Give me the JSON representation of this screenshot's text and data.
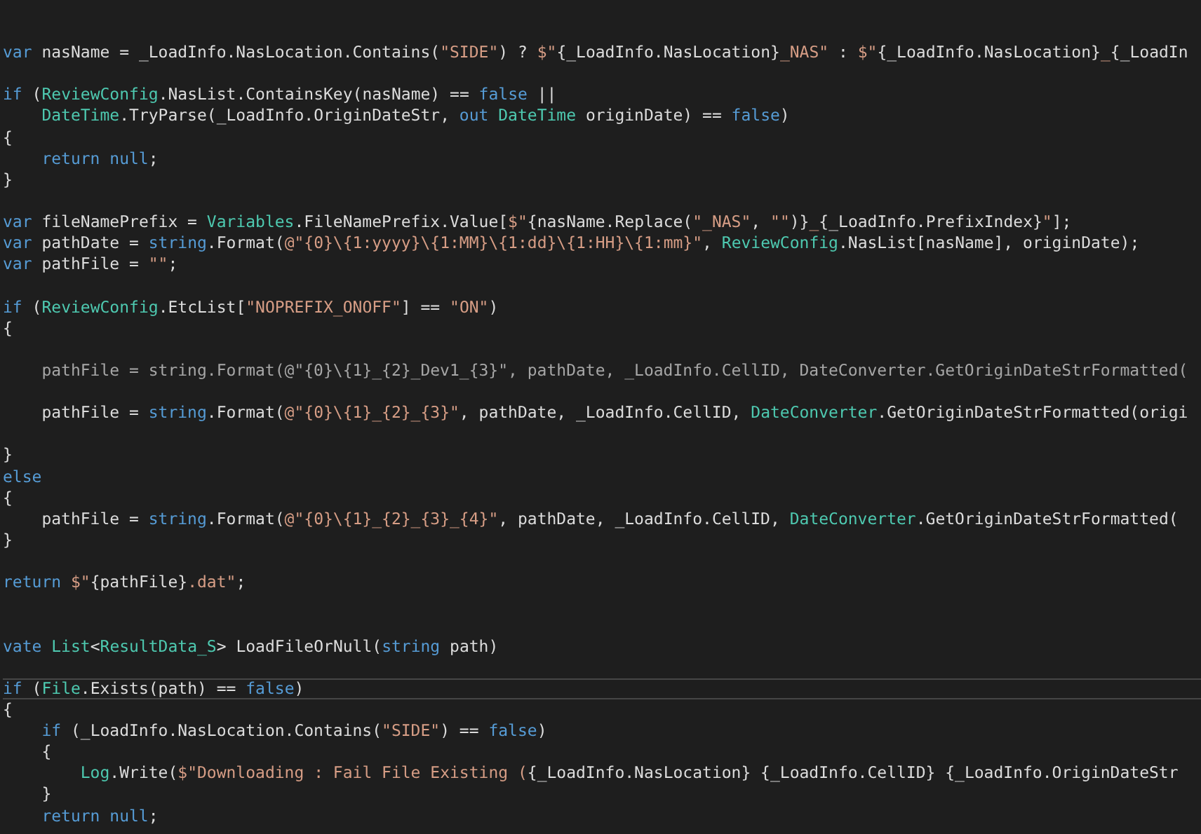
{
  "editor": {
    "lines": [
      {
        "kind": "code",
        "current": false,
        "tokens": [
          {
            "kind": "kw",
            "text": "var"
          },
          {
            "kind": "plain",
            "text": " nasName = _LoadInfo.NasLocation.Contains("
          },
          {
            "kind": "str",
            "text": "\"SIDE\""
          },
          {
            "kind": "plain",
            "text": ") ? "
          },
          {
            "kind": "str",
            "text": "$\""
          },
          {
            "kind": "plain",
            "text": "{_LoadInfo.NasLocation}"
          },
          {
            "kind": "str",
            "text": "_NAS\""
          },
          {
            "kind": "plain",
            "text": " : "
          },
          {
            "kind": "str",
            "text": "$\""
          },
          {
            "kind": "plain",
            "text": "{_LoadInfo.NasLocation}"
          },
          {
            "kind": "str",
            "text": "_"
          },
          {
            "kind": "plain",
            "text": "{_LoadIn"
          }
        ]
      },
      {
        "kind": "blank"
      },
      {
        "kind": "code",
        "current": false,
        "tokens": [
          {
            "kind": "kw",
            "text": "if"
          },
          {
            "kind": "plain",
            "text": " ("
          },
          {
            "kind": "type",
            "text": "ReviewConfig"
          },
          {
            "kind": "plain",
            "text": ".NasList.ContainsKey(nasName) == "
          },
          {
            "kind": "kw",
            "text": "false"
          },
          {
            "kind": "plain",
            "text": " ||"
          }
        ]
      },
      {
        "kind": "code",
        "current": false,
        "tokens": [
          {
            "kind": "type",
            "text": "    DateTime"
          },
          {
            "kind": "plain",
            "text": ".TryParse(_LoadInfo.OriginDateStr, "
          },
          {
            "kind": "kw",
            "text": "out "
          },
          {
            "kind": "type",
            "text": "DateTime"
          },
          {
            "kind": "plain",
            "text": " originDate) == "
          },
          {
            "kind": "kw",
            "text": "false"
          },
          {
            "kind": "plain",
            "text": ")"
          }
        ]
      },
      {
        "kind": "code",
        "current": false,
        "tokens": [
          {
            "kind": "plain",
            "text": "{"
          }
        ]
      },
      {
        "kind": "code",
        "current": false,
        "tokens": [
          {
            "kind": "kw",
            "text": "    return null"
          },
          {
            "kind": "plain",
            "text": ";"
          }
        ]
      },
      {
        "kind": "code",
        "current": false,
        "tokens": [
          {
            "kind": "plain",
            "text": "}"
          }
        ]
      },
      {
        "kind": "blank"
      },
      {
        "kind": "code",
        "current": false,
        "tokens": [
          {
            "kind": "kw",
            "text": "var"
          },
          {
            "kind": "plain",
            "text": " fileNamePrefix = "
          },
          {
            "kind": "type",
            "text": "Variables"
          },
          {
            "kind": "plain",
            "text": ".FileNamePrefix.Value["
          },
          {
            "kind": "str",
            "text": "$\""
          },
          {
            "kind": "plain",
            "text": "{nasName.Replace("
          },
          {
            "kind": "str",
            "text": "\"_NAS\""
          },
          {
            "kind": "plain",
            "text": ", "
          },
          {
            "kind": "str",
            "text": "\"\""
          },
          {
            "kind": "plain",
            "text": ")}"
          },
          {
            "kind": "str",
            "text": "_"
          },
          {
            "kind": "plain",
            "text": "{_LoadInfo.PrefixIndex}"
          },
          {
            "kind": "str",
            "text": "\""
          },
          {
            "kind": "plain",
            "text": "];"
          }
        ]
      },
      {
        "kind": "code",
        "current": false,
        "tokens": [
          {
            "kind": "kw",
            "text": "var"
          },
          {
            "kind": "plain",
            "text": " pathDate = "
          },
          {
            "kind": "kw",
            "text": "string"
          },
          {
            "kind": "plain",
            "text": ".Format("
          },
          {
            "kind": "str",
            "text": "@\"{0}\\{1:yyyy}\\{1:MM}\\{1:dd}\\{1:HH}\\{1:mm}\""
          },
          {
            "kind": "plain",
            "text": ", "
          },
          {
            "kind": "type",
            "text": "ReviewConfig"
          },
          {
            "kind": "plain",
            "text": ".NasList[nasName], originDate);"
          }
        ]
      },
      {
        "kind": "code",
        "current": false,
        "tokens": [
          {
            "kind": "kw",
            "text": "var"
          },
          {
            "kind": "plain",
            "text": " pathFile = "
          },
          {
            "kind": "str",
            "text": "\"\""
          },
          {
            "kind": "plain",
            "text": ";"
          }
        ]
      },
      {
        "kind": "blank"
      },
      {
        "kind": "code",
        "current": false,
        "tokens": [
          {
            "kind": "kw",
            "text": "if"
          },
          {
            "kind": "plain",
            "text": " ("
          },
          {
            "kind": "type",
            "text": "ReviewConfig"
          },
          {
            "kind": "plain",
            "text": ".EtcList["
          },
          {
            "kind": "str",
            "text": "\"NOPREFIX_ONOFF\""
          },
          {
            "kind": "plain",
            "text": "] == "
          },
          {
            "kind": "str",
            "text": "\"ON\""
          },
          {
            "kind": "plain",
            "text": ")"
          }
        ]
      },
      {
        "kind": "code",
        "current": false,
        "tokens": [
          {
            "kind": "plain",
            "text": "{"
          }
        ]
      },
      {
        "kind": "blank"
      },
      {
        "kind": "code",
        "current": false,
        "tokens": [
          {
            "kind": "dim",
            "text": "    pathFile = string.Format(@\"{0}\\{1}_{2}_Dev1_{3}\", pathDate, _LoadInfo.CellID, DateConverter.GetOriginDateStrFormatted("
          }
        ]
      },
      {
        "kind": "blank"
      },
      {
        "kind": "code",
        "current": false,
        "tokens": [
          {
            "kind": "plain",
            "text": "    pathFile = "
          },
          {
            "kind": "kw",
            "text": "string"
          },
          {
            "kind": "plain",
            "text": ".Format("
          },
          {
            "kind": "str",
            "text": "@\"{0}\\{1}_{2}_{3}\""
          },
          {
            "kind": "plain",
            "text": ", pathDate, _LoadInfo.CellID, "
          },
          {
            "kind": "type",
            "text": "DateConverter"
          },
          {
            "kind": "plain",
            "text": ".GetOriginDateStrFormatted(origi"
          }
        ]
      },
      {
        "kind": "blank"
      },
      {
        "kind": "code",
        "current": false,
        "tokens": [
          {
            "kind": "plain",
            "text": "}"
          }
        ]
      },
      {
        "kind": "code",
        "current": false,
        "tokens": [
          {
            "kind": "kw",
            "text": "else"
          }
        ]
      },
      {
        "kind": "code",
        "current": false,
        "tokens": [
          {
            "kind": "plain",
            "text": "{"
          }
        ]
      },
      {
        "kind": "code",
        "current": false,
        "tokens": [
          {
            "kind": "plain",
            "text": "    pathFile = "
          },
          {
            "kind": "kw",
            "text": "string"
          },
          {
            "kind": "plain",
            "text": ".Format("
          },
          {
            "kind": "str",
            "text": "@\"{0}\\{1}_{2}_{3}_{4}\""
          },
          {
            "kind": "plain",
            "text": ", pathDate, _LoadInfo.CellID, "
          },
          {
            "kind": "type",
            "text": "DateConverter"
          },
          {
            "kind": "plain",
            "text": ".GetOriginDateStrFormatted("
          }
        ]
      },
      {
        "kind": "code",
        "current": false,
        "tokens": [
          {
            "kind": "plain",
            "text": "}"
          }
        ]
      },
      {
        "kind": "blank"
      },
      {
        "kind": "code",
        "current": false,
        "tokens": [
          {
            "kind": "kw",
            "text": "return "
          },
          {
            "kind": "str",
            "text": "$\""
          },
          {
            "kind": "plain",
            "text": "{pathFile}"
          },
          {
            "kind": "str",
            "text": ".dat\""
          },
          {
            "kind": "plain",
            "text": ";"
          }
        ]
      },
      {
        "kind": "blank"
      },
      {
        "kind": "blank"
      },
      {
        "kind": "code",
        "current": false,
        "tokens": [
          {
            "kind": "kw",
            "text": "vate "
          },
          {
            "kind": "type",
            "text": "List"
          },
          {
            "kind": "plain",
            "text": "<"
          },
          {
            "kind": "type",
            "text": "ResultData_S"
          },
          {
            "kind": "plain",
            "text": "> LoadFileOrNull("
          },
          {
            "kind": "kw",
            "text": "string"
          },
          {
            "kind": "plain",
            "text": " path)"
          }
        ]
      },
      {
        "kind": "blank"
      },
      {
        "kind": "code",
        "current": true,
        "tokens": [
          {
            "kind": "kw",
            "text": "if"
          },
          {
            "kind": "plain",
            "text": " ("
          },
          {
            "kind": "type",
            "text": "File"
          },
          {
            "kind": "plain",
            "text": ".Exists(path) == "
          },
          {
            "kind": "kw",
            "text": "false"
          },
          {
            "kind": "plain",
            "text": ")"
          }
        ]
      },
      {
        "kind": "code",
        "current": false,
        "tokens": [
          {
            "kind": "plain",
            "text": "{"
          }
        ]
      },
      {
        "kind": "code",
        "current": false,
        "tokens": [
          {
            "kind": "kw",
            "text": "    if"
          },
          {
            "kind": "plain",
            "text": " (_LoadInfo.NasLocation.Contains("
          },
          {
            "kind": "str",
            "text": "\"SIDE\""
          },
          {
            "kind": "plain",
            "text": ") == "
          },
          {
            "kind": "kw",
            "text": "false"
          },
          {
            "kind": "plain",
            "text": ")"
          }
        ]
      },
      {
        "kind": "code",
        "current": false,
        "tokens": [
          {
            "kind": "plain",
            "text": "    {"
          }
        ]
      },
      {
        "kind": "code",
        "current": false,
        "tokens": [
          {
            "kind": "type",
            "text": "        Log"
          },
          {
            "kind": "plain",
            "text": ".Write("
          },
          {
            "kind": "str",
            "text": "$\"Downloading : Fail File Existing ("
          },
          {
            "kind": "plain",
            "text": "{_LoadInfo.NasLocation} {_LoadInfo.CellID} {_LoadInfo.OriginDateStr"
          }
        ]
      },
      {
        "kind": "code",
        "current": false,
        "tokens": [
          {
            "kind": "plain",
            "text": "    }"
          }
        ]
      },
      {
        "kind": "code",
        "current": false,
        "tokens": [
          {
            "kind": "kw",
            "text": "    return null"
          },
          {
            "kind": "plain",
            "text": ";"
          }
        ]
      }
    ]
  }
}
